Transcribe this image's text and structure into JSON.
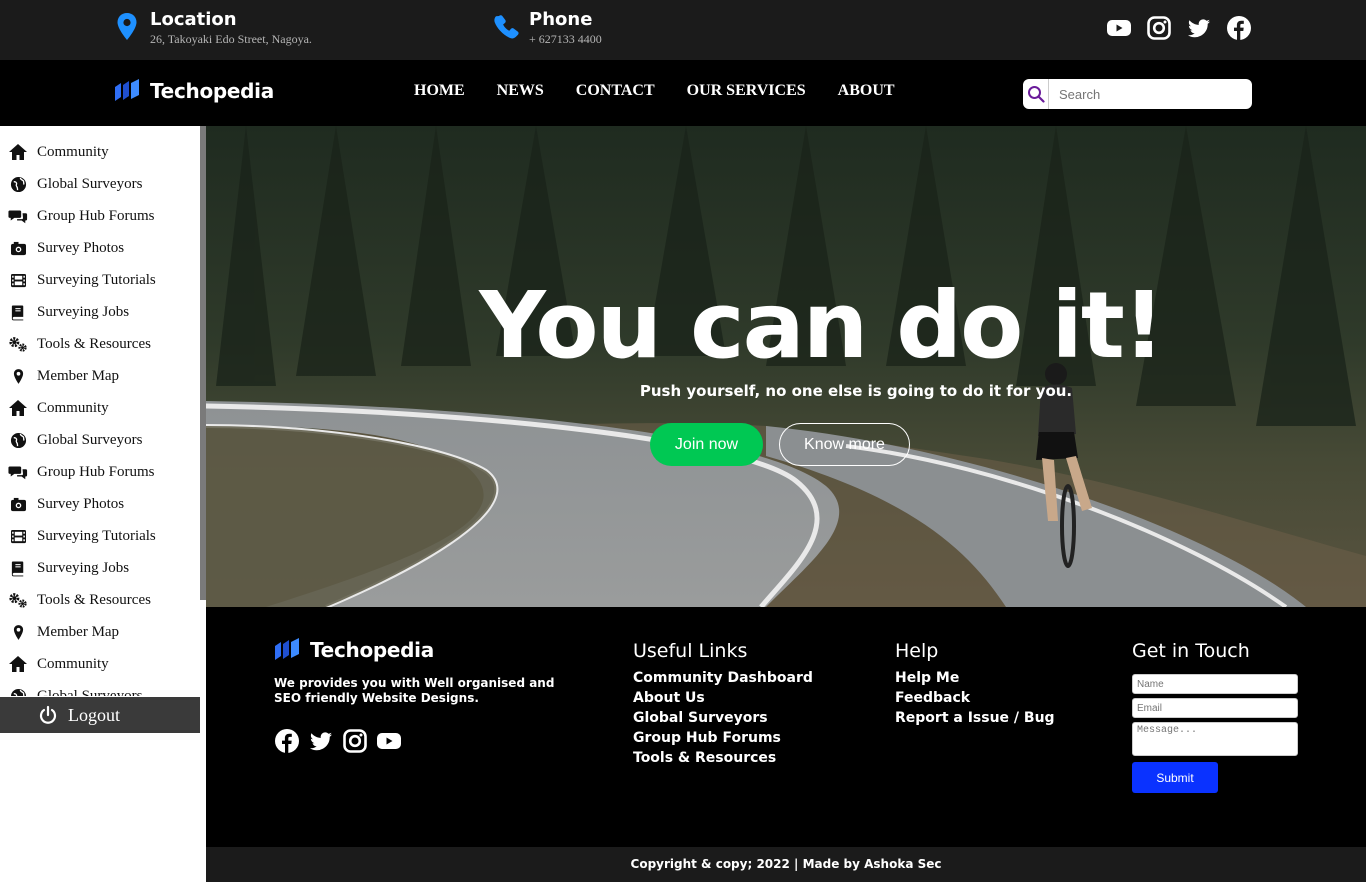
{
  "topbar": {
    "location": {
      "title": "Location",
      "detail": "26, Takoyaki Edo Street, Nagoya."
    },
    "phone": {
      "title": "Phone",
      "detail": "+ 627133 4400"
    },
    "socials": [
      "youtube-icon",
      "instagram-icon",
      "twitter-icon",
      "facebook-icon"
    ]
  },
  "navbar": {
    "brand": "Techopedia",
    "menu": [
      "HOME",
      "NEWS",
      "CONTACT",
      "OUR SERVICES",
      "ABOUT"
    ],
    "search_placeholder": "Search"
  },
  "sidebar": {
    "items": [
      {
        "label": "Community",
        "icon": "home-icon"
      },
      {
        "label": "Global Surveyors",
        "icon": "globe-icon"
      },
      {
        "label": "Group Hub Forums",
        "icon": "comments-icon"
      },
      {
        "label": "Survey Photos",
        "icon": "camera-icon"
      },
      {
        "label": "Surveying Tutorials",
        "icon": "film-icon"
      },
      {
        "label": "Surveying Jobs",
        "icon": "book-icon"
      },
      {
        "label": "Tools & Resources",
        "icon": "cogs-icon"
      },
      {
        "label": "Member Map",
        "icon": "map-pin-icon"
      },
      {
        "label": "Community",
        "icon": "home-icon"
      },
      {
        "label": "Global Surveyors",
        "icon": "globe-icon"
      },
      {
        "label": "Group Hub Forums",
        "icon": "comments-icon"
      },
      {
        "label": "Survey Photos",
        "icon": "camera-icon"
      },
      {
        "label": "Surveying Tutorials",
        "icon": "film-icon"
      },
      {
        "label": "Surveying Jobs",
        "icon": "book-icon"
      },
      {
        "label": "Tools & Resources",
        "icon": "cogs-icon"
      },
      {
        "label": "Member Map",
        "icon": "map-pin-icon"
      },
      {
        "label": "Community",
        "icon": "home-icon"
      },
      {
        "label": "Global Surveyors",
        "icon": "globe-icon"
      }
    ],
    "logout": "Logout"
  },
  "hero": {
    "title": "You can do it!",
    "subtitle": "Push yourself, no one else is going to do it for you.",
    "join": "Join now",
    "more": "Know more"
  },
  "footer": {
    "brand": "Techopedia",
    "description": "We provides you with Well organised and SEO friendly Website Designs.",
    "socials": [
      "facebook-icon",
      "twitter-icon",
      "instagram-icon",
      "youtube-icon"
    ],
    "useful_links": {
      "title": "Useful Links",
      "links": [
        "Community Dashboard",
        "About Us",
        "Global Surveyors",
        "Group Hub Forums",
        "Tools & Resources"
      ]
    },
    "help": {
      "title": "Help",
      "links": [
        "Help Me",
        "Feedback",
        "Report a Issue / Bug"
      ]
    },
    "contact": {
      "title": "Get in Touch",
      "name_placeholder": "Name",
      "email_placeholder": "Email",
      "message_placeholder": "Message...",
      "submit": "Submit"
    },
    "copyright": "Copyright & copy; 2022 | Made by Ashoka Sec"
  },
  "colors": {
    "accent_blue": "#1e90ff",
    "join_green": "#00c853",
    "submit_blue": "#0a32ff",
    "topbar_bg": "#1b1b1b",
    "nav_bg": "#000000"
  }
}
